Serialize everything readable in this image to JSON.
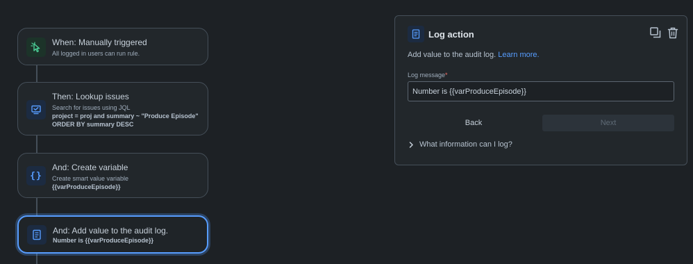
{
  "flow": {
    "trigger": {
      "title": "When: Manually triggered",
      "sub": "All logged in users can run rule.",
      "icon": "cursor-click-icon"
    },
    "lookup": {
      "title": "Then: Lookup issues",
      "sub": "Search for issues using JQL",
      "jql_line1": "project = proj and summary ~ \"Produce Episode\"",
      "jql_line2": "ORDER BY summary DESC",
      "icon": "monitor-check-icon"
    },
    "variable": {
      "title": "And: Create variable",
      "sub": "Create smart value variable",
      "var": "{{varProduceEpisode}}",
      "icon": "braces-icon"
    },
    "audit": {
      "title": "And: Add value to the audit log.",
      "value": "Number is {{varProduceEpisode}}",
      "icon": "document-icon"
    }
  },
  "panel": {
    "title": "Log action",
    "description": "Add value to the audit log.",
    "learn_more": "Learn more.",
    "field_label": "Log message",
    "required_mark": "*",
    "field_value": "Number is {{varProduceEpisode}}",
    "back_label": "Back",
    "next_label": "Next",
    "disclosure": "What information can I log?"
  },
  "colors": {
    "background": "#1d2125",
    "card": "#22272b",
    "accent": "#579dff",
    "trigger_icon": "#4bce97"
  }
}
